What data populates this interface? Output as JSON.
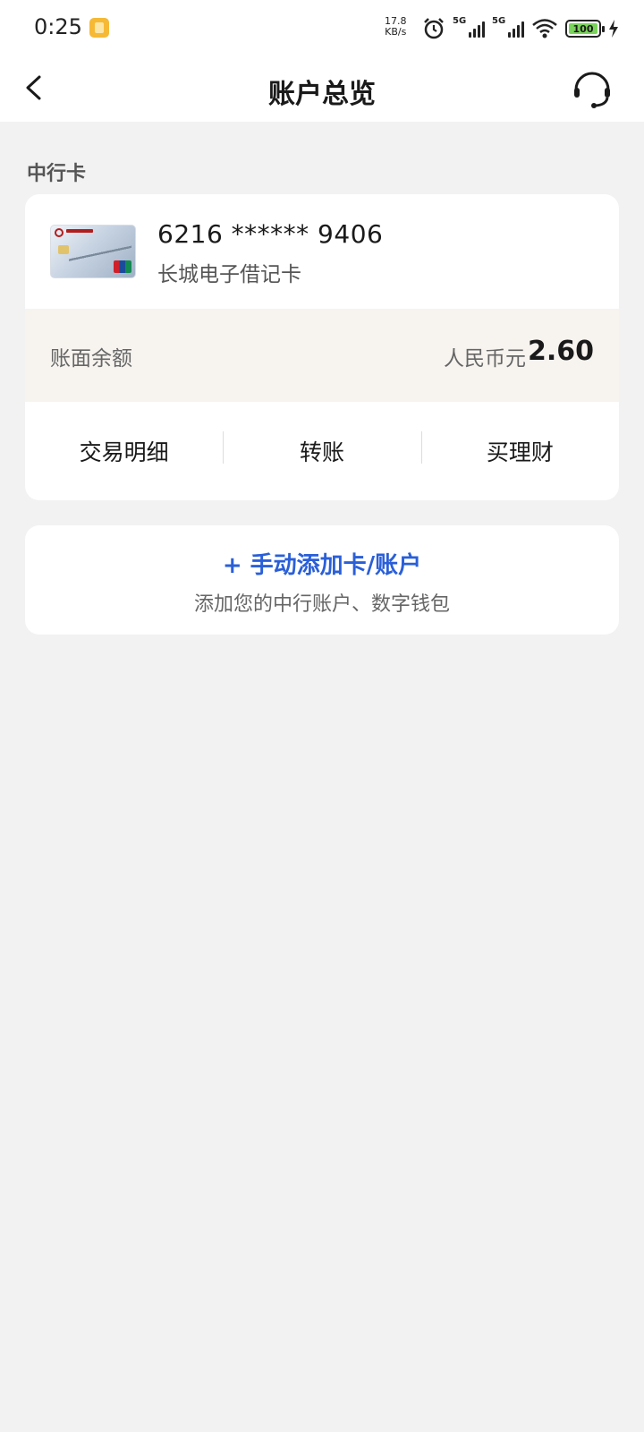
{
  "status_bar": {
    "time": "0:25",
    "net_speed_value": "17.8",
    "net_speed_unit": "KB/s",
    "signal1_label": "5G",
    "signal2_label": "5G",
    "battery_level": "100"
  },
  "header": {
    "title": "账户总览"
  },
  "section": {
    "label": "中行卡"
  },
  "card": {
    "number": "6216 ****** 9406",
    "name": "长城电子借记卡",
    "balance_label": "账面余额",
    "currency": "人民币元",
    "balance": "2.60",
    "actions": [
      {
        "label": "交易明细"
      },
      {
        "label": "转账"
      },
      {
        "label": "买理财"
      }
    ]
  },
  "add_card": {
    "title": "+ 手动添加卡/账户",
    "subtitle": "添加您的中行账户、数字钱包"
  },
  "colors": {
    "accent": "#2a5fd8",
    "background": "#f2f2f2",
    "balance_row": "#f7f4f0"
  }
}
